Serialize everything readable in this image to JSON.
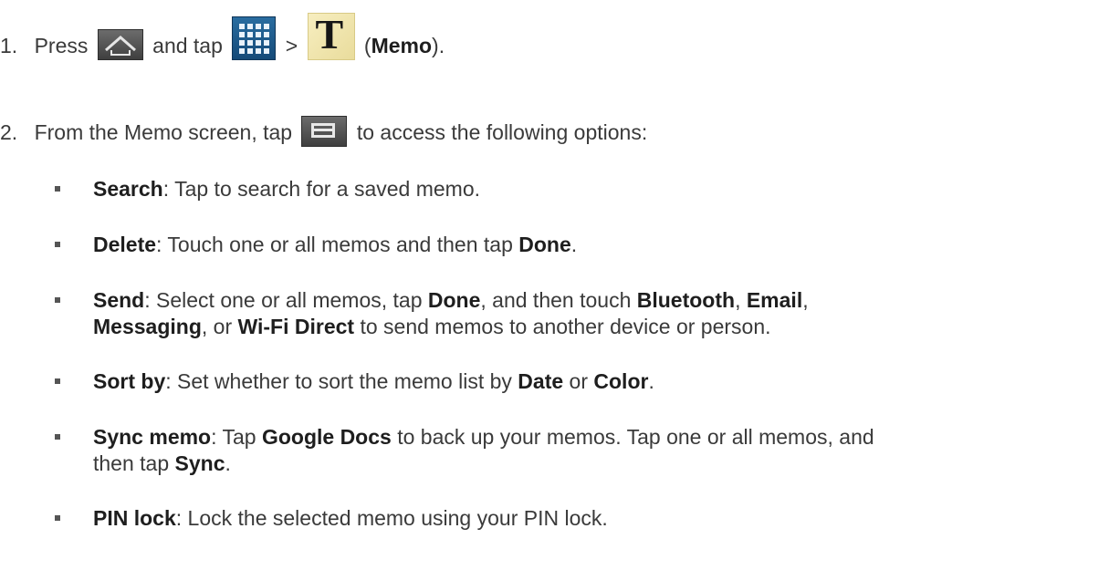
{
  "steps": [
    {
      "number": "1.",
      "press": "Press",
      "and_tap": "and tap",
      "arrow": ">",
      "open_paren": "(",
      "app_name": "Memo",
      "close_paren": ")."
    },
    {
      "number": "2.",
      "before_icon": "From the Memo screen, tap",
      "after_icon": "to access the following options:"
    }
  ],
  "icons": {
    "home": "home-key-icon",
    "apps": "apps-grid-icon",
    "memo": "memo-app-icon",
    "menu": "menu-key-icon",
    "memo_glyph": "T"
  },
  "options": {
    "search": {
      "term": "Search",
      "text": ": Tap to search for a saved memo."
    },
    "delete": {
      "term": "Delete",
      "text": ": Touch one or all memos and then tap ",
      "b1": "Done",
      "end": "."
    },
    "send": {
      "term": "Send",
      "t1": ": Select one or all memos, tap ",
      "b1": "Done",
      "t2": ", and then touch ",
      "b2": "Bluetooth",
      "t3": ", ",
      "b3": "Email",
      "t4": ",",
      "b4": "Messaging",
      "t5": ", or ",
      "b5": "Wi-Fi Direct",
      "t6": " to send memos to another device or person."
    },
    "sort": {
      "term": "Sort by",
      "t1": ": Set whether to sort the memo list by ",
      "b1": "Date",
      "t2": " or ",
      "b2": "Color",
      "end": "."
    },
    "sync": {
      "term": "Sync memo",
      "t1": ": Tap ",
      "b1": "Google Docs",
      "t2": " to back up your memos. Tap one or all memos, and",
      "t3": "then tap ",
      "b2": "Sync",
      "end": "."
    },
    "pin": {
      "term": "PIN lock",
      "text": ": Lock the selected memo using your PIN lock."
    }
  }
}
